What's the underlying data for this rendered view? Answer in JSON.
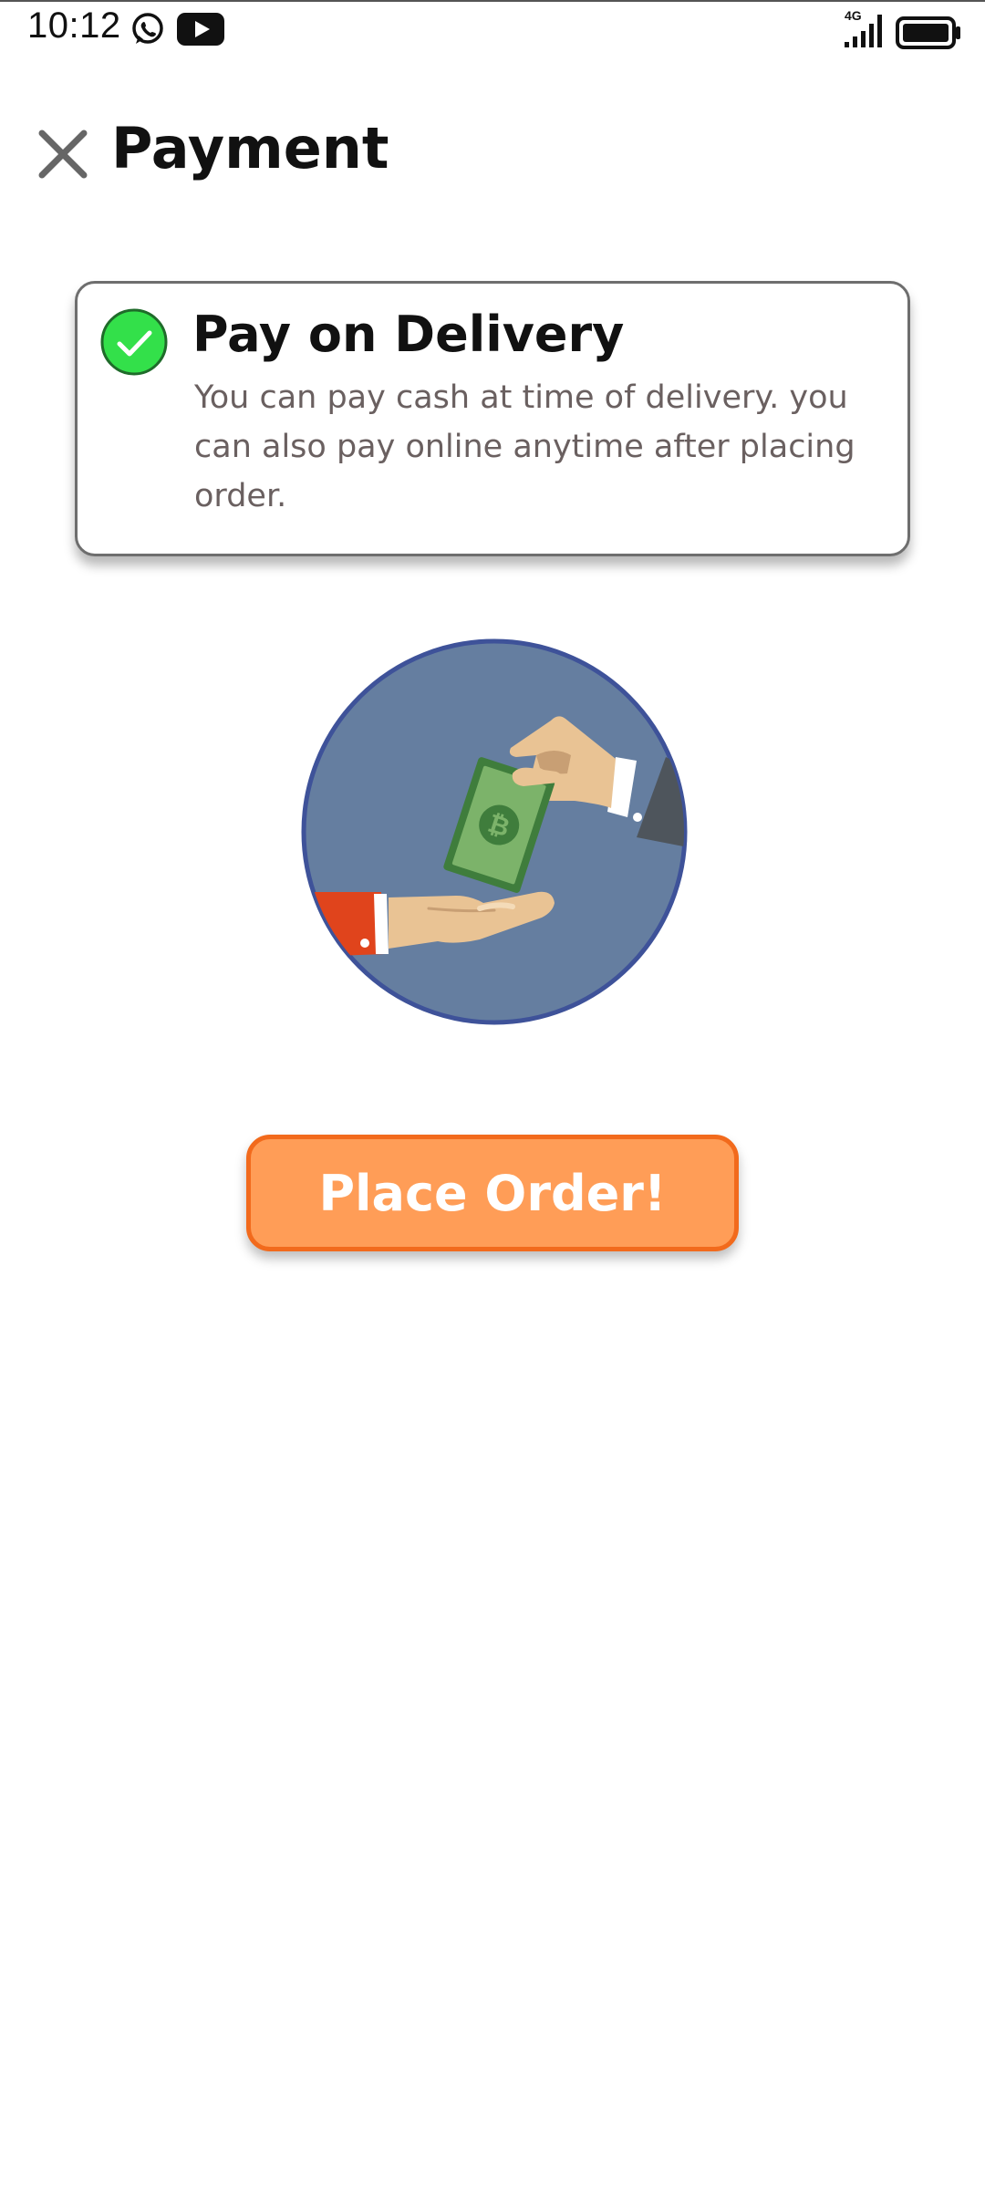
{
  "status_bar": {
    "time": "10:12",
    "network": "4G",
    "icons": [
      "whatsapp-icon",
      "youtube-icon",
      "signal-icon",
      "battery-icon"
    ]
  },
  "header": {
    "title": "Payment",
    "close_icon": "close-icon"
  },
  "payment_option": {
    "title": "Pay on Delivery",
    "description": "You can pay cash at time of delivery. you can also pay online anytime after placing order.",
    "selected": true,
    "check_color": "#33e04a"
  },
  "illustration": {
    "icon": "cash-payment-icon",
    "circle_color": "#657ea0",
    "ring_color": "#3e5299"
  },
  "actions": {
    "place_order_label": "Place Order!",
    "button_color": "#ff9d57",
    "button_border": "#f26a1c"
  }
}
